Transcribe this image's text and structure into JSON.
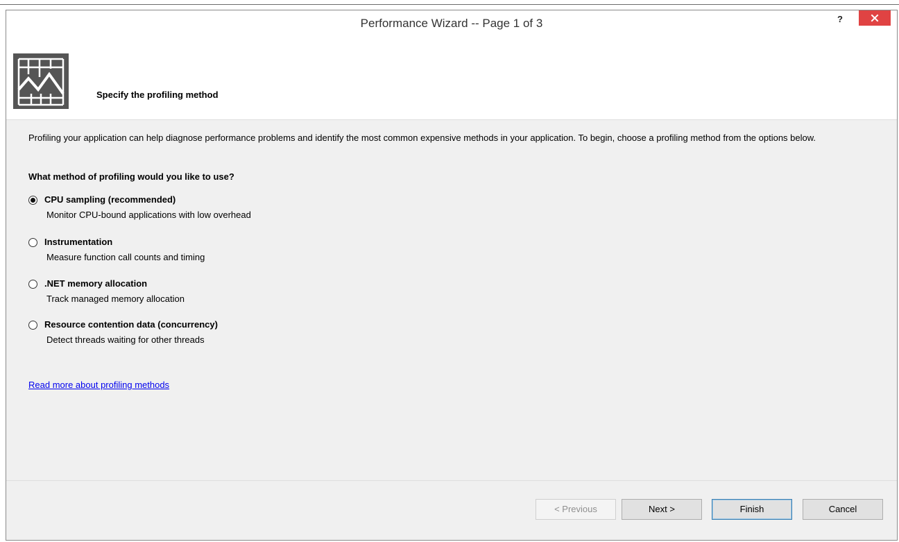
{
  "window": {
    "title": "Performance Wizard -- Page 1 of 3",
    "help_label": "?",
    "close_label": "×"
  },
  "header": {
    "title": "Specify the profiling method",
    "icon": "performance-chart-icon"
  },
  "content": {
    "intro": "Profiling your application can help diagnose performance problems and identify the most common expensive methods in your application. To begin, choose a profiling method from the options below.",
    "question": "What method of profiling would you like to use?",
    "options": [
      {
        "label": "CPU sampling (recommended)",
        "description": "Monitor CPU-bound applications with low overhead",
        "checked": true
      },
      {
        "label": "Instrumentation",
        "description": "Measure function call counts and timing",
        "checked": false
      },
      {
        "label": ".NET memory allocation",
        "description": "Track managed memory allocation",
        "checked": false
      },
      {
        "label": "Resource contention data (concurrency)",
        "description": "Detect threads waiting for other threads",
        "checked": false
      }
    ],
    "read_more": "Read more about profiling methods"
  },
  "buttons": {
    "previous": "< Previous",
    "next": "Next >",
    "finish": "Finish",
    "cancel": "Cancel"
  },
  "colors": {
    "close_button": "#e04343",
    "link": "#0000ee",
    "icon_bg": "#555555"
  }
}
